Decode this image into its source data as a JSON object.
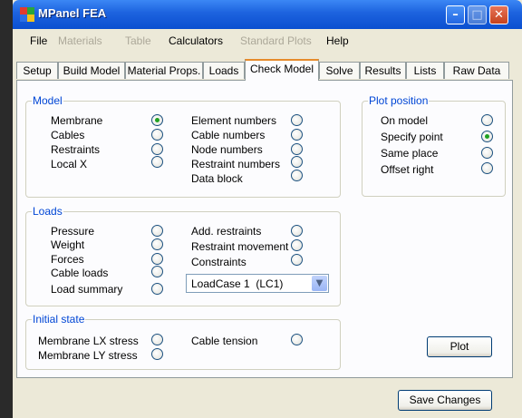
{
  "window": {
    "title": "MPanel FEA"
  },
  "menu": [
    {
      "label": "File",
      "enabled": true
    },
    {
      "label": "Materials",
      "enabled": false
    },
    {
      "label": "Table",
      "enabled": false
    },
    {
      "label": "Calculators",
      "enabled": true
    },
    {
      "label": "Standard Plots",
      "enabled": false
    },
    {
      "label": "Help",
      "enabled": true
    }
  ],
  "tabs": [
    "Setup",
    "Build Model",
    "Material Props.",
    "Loads",
    "Check Model",
    "Solve",
    "Results",
    "Lists",
    "Raw Data"
  ],
  "active_tab": "Check Model",
  "model_group": {
    "title": "Model",
    "left": [
      {
        "label": "Membrane",
        "checked": true
      },
      {
        "label": "Cables",
        "checked": false
      },
      {
        "label": "Restraints",
        "checked": false
      },
      {
        "label": "Local X",
        "checked": false
      }
    ],
    "right": [
      {
        "label": "Element numbers",
        "checked": false
      },
      {
        "label": "Cable numbers",
        "checked": false
      },
      {
        "label": "Node numbers",
        "checked": false
      },
      {
        "label": "Restraint numbers",
        "checked": false
      },
      {
        "label": "Data block",
        "checked": false
      }
    ]
  },
  "loads_group": {
    "title": "Loads",
    "left": [
      {
        "label": "Pressure",
        "checked": false
      },
      {
        "label": "Weight",
        "checked": false
      },
      {
        "label": "Forces",
        "checked": false
      },
      {
        "label": "Cable loads",
        "checked": false
      },
      {
        "label": "Load summary",
        "checked": false
      }
    ],
    "right": [
      {
        "label": "Add. restraints",
        "checked": false
      },
      {
        "label": "Restraint movement",
        "checked": false
      },
      {
        "label": "Constraints",
        "checked": false
      }
    ],
    "loadcase": "LoadCase 1  (LC1)"
  },
  "initial_state_group": {
    "title": "Initial state",
    "left": [
      {
        "label": "Membrane LX stress",
        "checked": false
      },
      {
        "label": "Membrane LY stress",
        "checked": false
      }
    ],
    "right": [
      {
        "label": "Cable tension",
        "checked": false
      }
    ]
  },
  "plot_position_group": {
    "title": "Plot position",
    "options": [
      {
        "label": "On model",
        "checked": false
      },
      {
        "label": "Specify point",
        "checked": true
      },
      {
        "label": "Same place",
        "checked": false
      },
      {
        "label": "Offset right",
        "checked": false
      }
    ]
  },
  "buttons": {
    "plot": "Plot",
    "save": "Save Changes"
  }
}
